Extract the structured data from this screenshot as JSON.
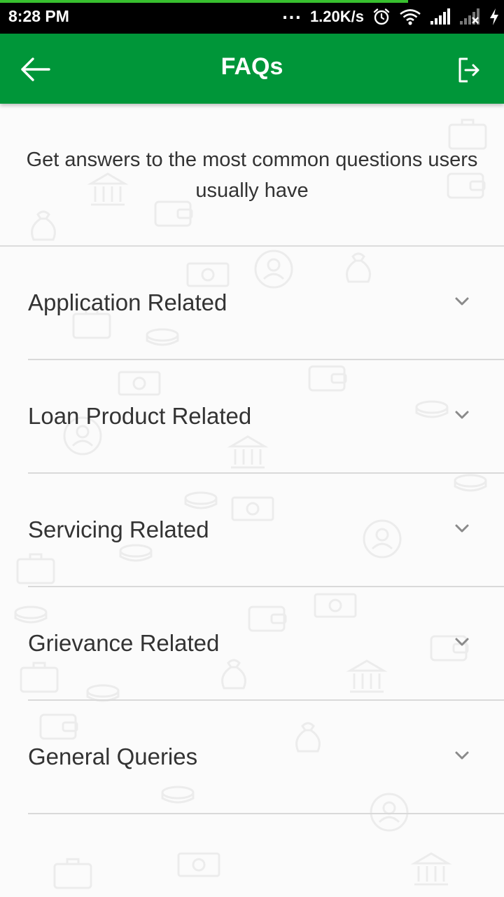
{
  "status_bar": {
    "time": "8:28 PM",
    "dots": "...",
    "network_speed": "1.20K/s",
    "icons": [
      "alarm-icon",
      "wifi-icon",
      "signal-icon",
      "signal-no-sim-icon",
      "charging-icon"
    ],
    "page_load_progress": 0.81
  },
  "app_bar": {
    "title": "FAQs",
    "back_icon": "arrow-left-icon",
    "logout_icon": "logout-icon",
    "color": "#009639"
  },
  "intro": {
    "text": "Get answers to the most common questions users usually have"
  },
  "faq_categories": [
    {
      "label": "Application Related",
      "expanded": false
    },
    {
      "label": "Loan Product Related",
      "expanded": false
    },
    {
      "label": "Servicing Related",
      "expanded": false
    },
    {
      "label": "Grievance Related",
      "expanded": false
    },
    {
      "label": "General Queries",
      "expanded": false
    }
  ],
  "colors": {
    "primary": "#009639",
    "progress": "#38c02f",
    "text": "#333333",
    "divider": "#d9d9d9"
  }
}
